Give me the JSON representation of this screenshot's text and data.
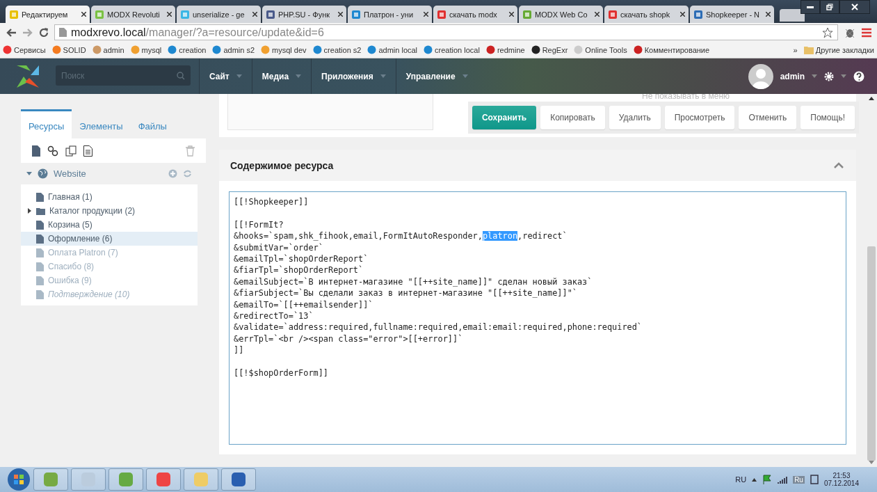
{
  "browser": {
    "tabs": [
      {
        "title": "Редактируем",
        "selected": true
      },
      {
        "title": "MODX Revoluti",
        "selected": false
      },
      {
        "title": "unserialize - ge",
        "selected": false
      },
      {
        "title": "PHP.SU - Функ",
        "selected": false
      },
      {
        "title": "Платрон - уни",
        "selected": false
      },
      {
        "title": "скачать modx",
        "selected": false
      },
      {
        "title": "MODX Web Co",
        "selected": false
      },
      {
        "title": "скачать shopk",
        "selected": false
      },
      {
        "title": "Shopkeeper - N",
        "selected": false
      }
    ],
    "url_host": "modxrevo.local",
    "url_path": "/manager/?a=resource/update&id=6",
    "bookmarks": [
      "Сервисы",
      "SOLID",
      "admin",
      "mysql",
      "creation",
      "admin s2",
      "mysql dev",
      "creation s2",
      "admin local",
      "creation local",
      "redmine",
      "RegExr",
      "Online Tools",
      "Комментирование"
    ],
    "bookmarks_more": "»",
    "other_bookmarks": "Другие закладки"
  },
  "header": {
    "search_placeholder": "Поиск",
    "nav": [
      "Сайт",
      "Медиа",
      "Приложения",
      "Управление"
    ],
    "user": "admin"
  },
  "sidebar": {
    "tabs": [
      {
        "label": "Ресурсы",
        "selected": true
      },
      {
        "label": "Элементы",
        "selected": false
      },
      {
        "label": "Файлы",
        "selected": false
      }
    ],
    "context": "Website",
    "tree": [
      {
        "label": "Главная (1)",
        "kind": "page",
        "published": true,
        "in_menu": true,
        "selected": false
      },
      {
        "label": "Каталог продукции (2)",
        "kind": "folder",
        "expanded": false,
        "published": true,
        "in_menu": true,
        "selected": false
      },
      {
        "label": "Корзина (5)",
        "kind": "page",
        "published": true,
        "in_menu": true,
        "selected": false
      },
      {
        "label": "Оформление (6)",
        "kind": "page",
        "published": true,
        "in_menu": true,
        "selected": true
      },
      {
        "label": "Оплата Platron (7)",
        "kind": "page",
        "published": false,
        "in_menu": true,
        "selected": false
      },
      {
        "label": "Спасибо (8)",
        "kind": "page",
        "published": false,
        "in_menu": true,
        "selected": false
      },
      {
        "label": "Ошибка (9)",
        "kind": "page",
        "published": false,
        "in_menu": true,
        "selected": false
      },
      {
        "label": "Подтверждение (10)",
        "kind": "page",
        "published": false,
        "in_menu": false,
        "selected": false
      }
    ]
  },
  "top_panel": {
    "hidden_option": "Не показывать в меню",
    "buttons": [
      {
        "label": "Сохранить",
        "kind": "primary"
      },
      {
        "label": "Копировать",
        "kind": "default"
      },
      {
        "label": "Удалить",
        "kind": "default"
      },
      {
        "label": "Просмотреть",
        "kind": "default"
      },
      {
        "label": "Отменить",
        "kind": "default"
      },
      {
        "label": "Помощь!",
        "kind": "default"
      }
    ]
  },
  "content_panel": {
    "title": "Содержимое ресурса",
    "expanded": true,
    "lines": [
      {
        "kind": "code",
        "segments": [
          {
            "text": "[[!Shopkeeper]]",
            "selected": false
          }
        ]
      },
      {
        "kind": "blank"
      },
      {
        "kind": "code",
        "segments": [
          {
            "text": "[[!FormIt?",
            "selected": false
          }
        ]
      },
      {
        "kind": "code",
        "segments": [
          {
            "text": "&hooks=`spam,shk_fihook,email,FormItAutoResponder,",
            "selected": false
          },
          {
            "text": "platron",
            "selected": true
          },
          {
            "text": ",redirect`",
            "selected": false
          }
        ]
      },
      {
        "kind": "code",
        "segments": [
          {
            "text": "&submitVar=`order`",
            "selected": false
          }
        ]
      },
      {
        "kind": "code",
        "segments": [
          {
            "text": "&emailTpl=`shopOrderReport`",
            "selected": false
          }
        ]
      },
      {
        "kind": "code",
        "segments": [
          {
            "text": "&fiarTpl=`shopOrderReport`",
            "selected": false
          }
        ]
      },
      {
        "kind": "code",
        "segments": [
          {
            "text": "&emailSubject=`В интернет-магазине \"[[++site_name]]\" сделан новый заказ`",
            "selected": false
          }
        ]
      },
      {
        "kind": "code",
        "segments": [
          {
            "text": "&fiarSubject=`Вы сделали заказ в интернет-магазине \"[[++site_name]]\"`",
            "selected": false
          }
        ]
      },
      {
        "kind": "code",
        "segments": [
          {
            "text": "&emailTo=`[[++emailsender]]`",
            "selected": false
          }
        ]
      },
      {
        "kind": "code",
        "segments": [
          {
            "text": "&redirectTo=`13`",
            "selected": false
          }
        ]
      },
      {
        "kind": "code",
        "segments": [
          {
            "text": "&validate=`address:required,fullname:required,email:email:required,phone:required`",
            "selected": false
          }
        ]
      },
      {
        "kind": "code",
        "segments": [
          {
            "text": "&errTpl=`<br /><span class=\"error\">[[+error]]`",
            "selected": false
          }
        ]
      },
      {
        "kind": "code",
        "segments": [
          {
            "text": "]]",
            "selected": false
          }
        ]
      },
      {
        "kind": "blank"
      },
      {
        "kind": "code",
        "segments": [
          {
            "text": "[[!$shopOrderForm]]",
            "selected": false
          }
        ]
      }
    ]
  },
  "taskbar": {
    "language": "RU",
    "tray_language": "Ru",
    "time": "21:53",
    "date": "07.12.2014"
  }
}
